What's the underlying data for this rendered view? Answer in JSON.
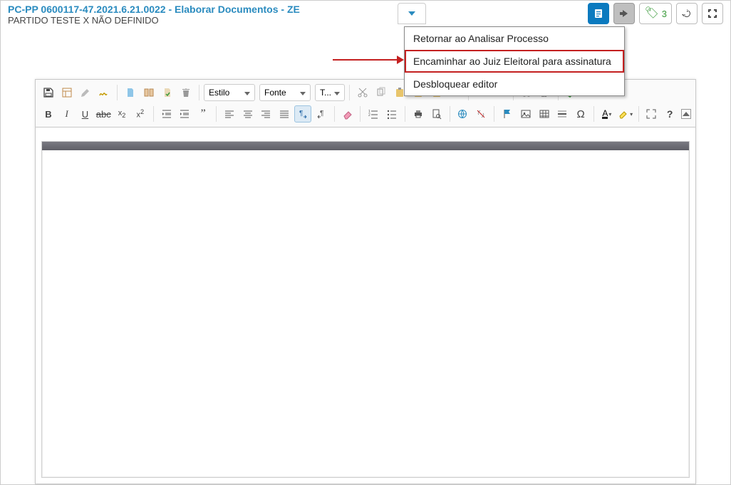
{
  "header": {
    "title": "PC-PP 0600117-47.2021.6.21.0022 - Elaborar Documentos - ZE",
    "subtitle": "PARTIDO TESTE X NÃO DEFINIDO"
  },
  "top_controls": {
    "tag_count": "3"
  },
  "dropdown": {
    "items": [
      "Retornar ao Analisar Processo",
      "Encaminhar ao Juiz Eleitoral para assinatura",
      "Desbloquear editor"
    ],
    "highlight_index": 1
  },
  "toolbar": {
    "style_label": "Estilo",
    "font_label": "Fonte",
    "size_label": "T..."
  }
}
